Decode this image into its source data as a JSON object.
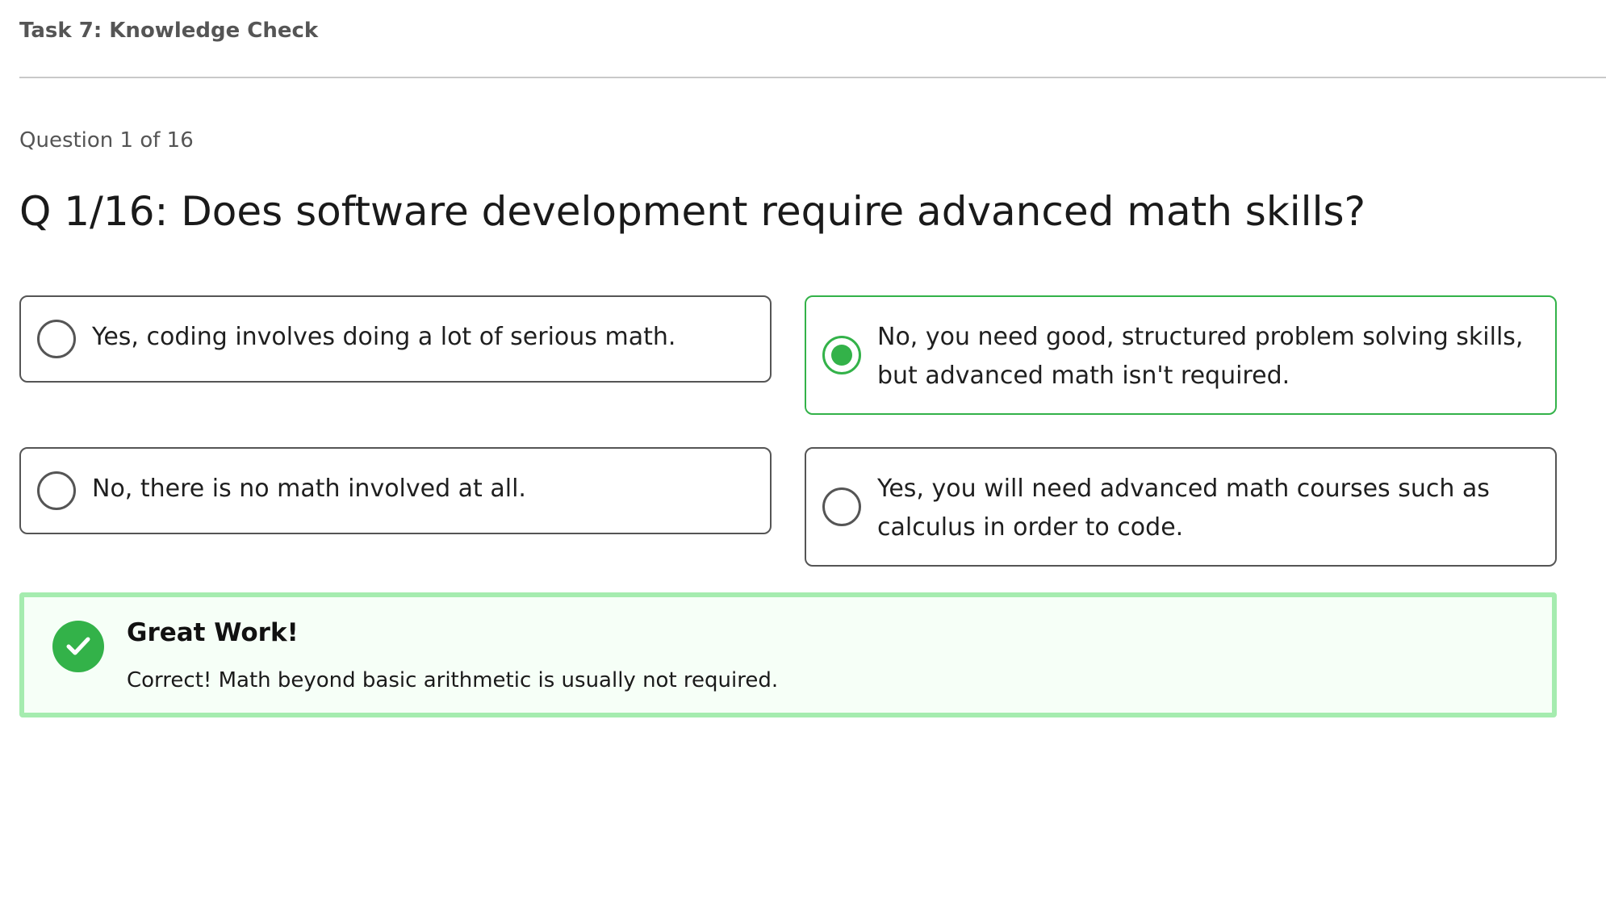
{
  "header": {
    "task_title": "Task 7: Knowledge Check"
  },
  "question": {
    "progress": "Question 1 of 16",
    "current": 1,
    "total": 16,
    "title": "Q 1/16: Does software development require advanced math skills?"
  },
  "options": [
    {
      "label": "Yes, coding involves doing a lot of serious math.",
      "selected": false
    },
    {
      "label": "No, you need good, structured problem solving skills, but advanced math isn't required.",
      "selected": true
    },
    {
      "label": "No, there is no math involved at all.",
      "selected": false
    },
    {
      "label": "Yes, you will need advanced math courses such as calculus in order to code.",
      "selected": false
    }
  ],
  "feedback": {
    "icon": "check-circle-icon",
    "title": "Great Work!",
    "message": "Correct! Math beyond basic arithmetic is usually not required.",
    "status": "correct"
  },
  "colors": {
    "accent_green": "#33b249",
    "feedback_border": "#a5ecaf",
    "feedback_bg": "#f6fff7",
    "option_border": "#555555"
  }
}
